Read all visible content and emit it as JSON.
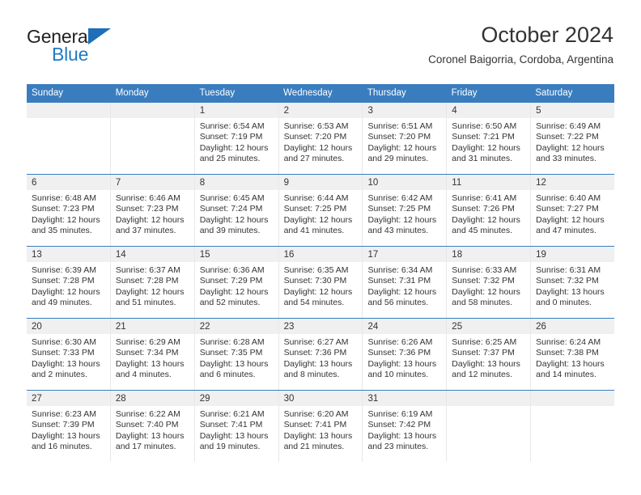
{
  "brand": {
    "name_top": "General",
    "name_bottom": "Blue",
    "triangle_icon": "triangle-icon",
    "color_dark": "#231f20",
    "color_blue": "#1f7ac4"
  },
  "header": {
    "title": "October 2024",
    "subtitle": "Coronel Baigorria, Cordoba, Argentina"
  },
  "theme": {
    "header_blue": "#3a7dbf",
    "day_number_band": "#f0f0f0",
    "cell_border": "#e8e8e8",
    "text": "#333333"
  },
  "calendar": {
    "weekdays": [
      "Sunday",
      "Monday",
      "Tuesday",
      "Wednesday",
      "Thursday",
      "Friday",
      "Saturday"
    ],
    "weeks": [
      [
        {
          "day": "",
          "sunrise": "",
          "sunset": "",
          "daylight": ""
        },
        {
          "day": "",
          "sunrise": "",
          "sunset": "",
          "daylight": ""
        },
        {
          "day": "1",
          "sunrise": "Sunrise: 6:54 AM",
          "sunset": "Sunset: 7:19 PM",
          "daylight": "Daylight: 12 hours and 25 minutes."
        },
        {
          "day": "2",
          "sunrise": "Sunrise: 6:53 AM",
          "sunset": "Sunset: 7:20 PM",
          "daylight": "Daylight: 12 hours and 27 minutes."
        },
        {
          "day": "3",
          "sunrise": "Sunrise: 6:51 AM",
          "sunset": "Sunset: 7:20 PM",
          "daylight": "Daylight: 12 hours and 29 minutes."
        },
        {
          "day": "4",
          "sunrise": "Sunrise: 6:50 AM",
          "sunset": "Sunset: 7:21 PM",
          "daylight": "Daylight: 12 hours and 31 minutes."
        },
        {
          "day": "5",
          "sunrise": "Sunrise: 6:49 AM",
          "sunset": "Sunset: 7:22 PM",
          "daylight": "Daylight: 12 hours and 33 minutes."
        }
      ],
      [
        {
          "day": "6",
          "sunrise": "Sunrise: 6:48 AM",
          "sunset": "Sunset: 7:23 PM",
          "daylight": "Daylight: 12 hours and 35 minutes."
        },
        {
          "day": "7",
          "sunrise": "Sunrise: 6:46 AM",
          "sunset": "Sunset: 7:23 PM",
          "daylight": "Daylight: 12 hours and 37 minutes."
        },
        {
          "day": "8",
          "sunrise": "Sunrise: 6:45 AM",
          "sunset": "Sunset: 7:24 PM",
          "daylight": "Daylight: 12 hours and 39 minutes."
        },
        {
          "day": "9",
          "sunrise": "Sunrise: 6:44 AM",
          "sunset": "Sunset: 7:25 PM",
          "daylight": "Daylight: 12 hours and 41 minutes."
        },
        {
          "day": "10",
          "sunrise": "Sunrise: 6:42 AM",
          "sunset": "Sunset: 7:25 PM",
          "daylight": "Daylight: 12 hours and 43 minutes."
        },
        {
          "day": "11",
          "sunrise": "Sunrise: 6:41 AM",
          "sunset": "Sunset: 7:26 PM",
          "daylight": "Daylight: 12 hours and 45 minutes."
        },
        {
          "day": "12",
          "sunrise": "Sunrise: 6:40 AM",
          "sunset": "Sunset: 7:27 PM",
          "daylight": "Daylight: 12 hours and 47 minutes."
        }
      ],
      [
        {
          "day": "13",
          "sunrise": "Sunrise: 6:39 AM",
          "sunset": "Sunset: 7:28 PM",
          "daylight": "Daylight: 12 hours and 49 minutes."
        },
        {
          "day": "14",
          "sunrise": "Sunrise: 6:37 AM",
          "sunset": "Sunset: 7:28 PM",
          "daylight": "Daylight: 12 hours and 51 minutes."
        },
        {
          "day": "15",
          "sunrise": "Sunrise: 6:36 AM",
          "sunset": "Sunset: 7:29 PM",
          "daylight": "Daylight: 12 hours and 52 minutes."
        },
        {
          "day": "16",
          "sunrise": "Sunrise: 6:35 AM",
          "sunset": "Sunset: 7:30 PM",
          "daylight": "Daylight: 12 hours and 54 minutes."
        },
        {
          "day": "17",
          "sunrise": "Sunrise: 6:34 AM",
          "sunset": "Sunset: 7:31 PM",
          "daylight": "Daylight: 12 hours and 56 minutes."
        },
        {
          "day": "18",
          "sunrise": "Sunrise: 6:33 AM",
          "sunset": "Sunset: 7:32 PM",
          "daylight": "Daylight: 12 hours and 58 minutes."
        },
        {
          "day": "19",
          "sunrise": "Sunrise: 6:31 AM",
          "sunset": "Sunset: 7:32 PM",
          "daylight": "Daylight: 13 hours and 0 minutes."
        }
      ],
      [
        {
          "day": "20",
          "sunrise": "Sunrise: 6:30 AM",
          "sunset": "Sunset: 7:33 PM",
          "daylight": "Daylight: 13 hours and 2 minutes."
        },
        {
          "day": "21",
          "sunrise": "Sunrise: 6:29 AM",
          "sunset": "Sunset: 7:34 PM",
          "daylight": "Daylight: 13 hours and 4 minutes."
        },
        {
          "day": "22",
          "sunrise": "Sunrise: 6:28 AM",
          "sunset": "Sunset: 7:35 PM",
          "daylight": "Daylight: 13 hours and 6 minutes."
        },
        {
          "day": "23",
          "sunrise": "Sunrise: 6:27 AM",
          "sunset": "Sunset: 7:36 PM",
          "daylight": "Daylight: 13 hours and 8 minutes."
        },
        {
          "day": "24",
          "sunrise": "Sunrise: 6:26 AM",
          "sunset": "Sunset: 7:36 PM",
          "daylight": "Daylight: 13 hours and 10 minutes."
        },
        {
          "day": "25",
          "sunrise": "Sunrise: 6:25 AM",
          "sunset": "Sunset: 7:37 PM",
          "daylight": "Daylight: 13 hours and 12 minutes."
        },
        {
          "day": "26",
          "sunrise": "Sunrise: 6:24 AM",
          "sunset": "Sunset: 7:38 PM",
          "daylight": "Daylight: 13 hours and 14 minutes."
        }
      ],
      [
        {
          "day": "27",
          "sunrise": "Sunrise: 6:23 AM",
          "sunset": "Sunset: 7:39 PM",
          "daylight": "Daylight: 13 hours and 16 minutes."
        },
        {
          "day": "28",
          "sunrise": "Sunrise: 6:22 AM",
          "sunset": "Sunset: 7:40 PM",
          "daylight": "Daylight: 13 hours and 17 minutes."
        },
        {
          "day": "29",
          "sunrise": "Sunrise: 6:21 AM",
          "sunset": "Sunset: 7:41 PM",
          "daylight": "Daylight: 13 hours and 19 minutes."
        },
        {
          "day": "30",
          "sunrise": "Sunrise: 6:20 AM",
          "sunset": "Sunset: 7:41 PM",
          "daylight": "Daylight: 13 hours and 21 minutes."
        },
        {
          "day": "31",
          "sunrise": "Sunrise: 6:19 AM",
          "sunset": "Sunset: 7:42 PM",
          "daylight": "Daylight: 13 hours and 23 minutes."
        },
        {
          "day": "",
          "sunrise": "",
          "sunset": "",
          "daylight": ""
        },
        {
          "day": "",
          "sunrise": "",
          "sunset": "",
          "daylight": ""
        }
      ]
    ]
  }
}
